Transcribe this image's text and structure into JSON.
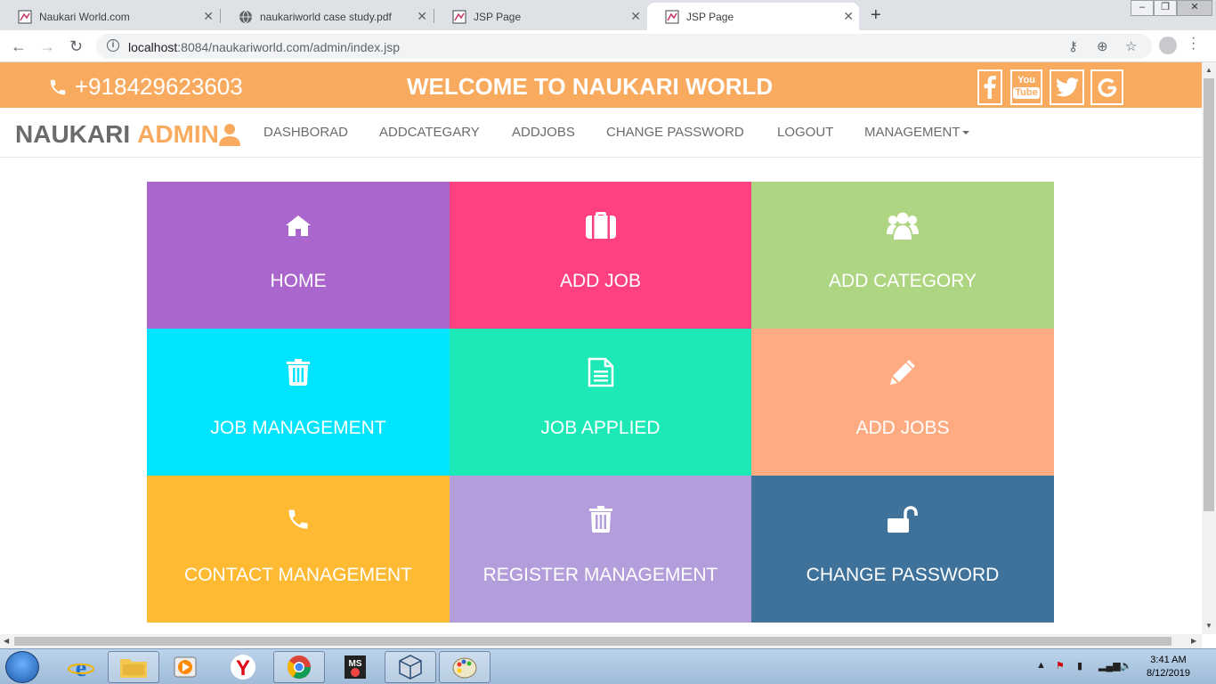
{
  "browser": {
    "tabs": [
      {
        "title": "Naukari World.com",
        "active": false
      },
      {
        "title": "naukariworld case study.pdf",
        "active": false
      },
      {
        "title": "JSP Page",
        "active": false
      },
      {
        "title": "JSP Page",
        "active": true
      }
    ],
    "url_host": "localhost",
    "url_rest": ":8084/naukariworld.com/admin/index.jsp"
  },
  "topbar": {
    "phone": "+918429623603",
    "welcome": "WELCOME TO NAUKARI WORLD",
    "social": [
      "facebook-icon",
      "youtube-icon",
      "twitter-icon",
      "google-icon"
    ]
  },
  "navbar": {
    "brand_main": "NAUKARI",
    "brand_accent": "ADMIN",
    "links": [
      "DASHBORAD",
      "ADDCATEGARY",
      "ADDJOBS",
      "CHANGE PASSWORD",
      "LOGOUT",
      "MANAGEMENT"
    ]
  },
  "tiles": [
    {
      "label": "HOME",
      "icon": "home-icon",
      "color": "#aa66cc"
    },
    {
      "label": "ADD JOB",
      "icon": "briefcase-icon",
      "color": "#ff4081"
    },
    {
      "label": "ADD CATEGORY",
      "icon": "users-icon",
      "color": "#aed581"
    },
    {
      "label": "JOB MANAGEMENT",
      "icon": "trash-icon",
      "color": "#00e5ff"
    },
    {
      "label": "JOB APPLIED",
      "icon": "document-icon",
      "color": "#1de9b6"
    },
    {
      "label": "ADD JOBS",
      "icon": "pencil-icon",
      "color": "#ffab82"
    },
    {
      "label": "CONTACT MANAGEMENT",
      "icon": "phone-icon",
      "color": "#ffba33"
    },
    {
      "label": "REGISTER MANAGEMENT",
      "icon": "trash-icon",
      "color": "#b39ddb"
    },
    {
      "label": "CHANGE PASSWORD",
      "icon": "unlock-icon",
      "color": "#3f729b"
    }
  ],
  "taskbar": {
    "time": "3:41 AM",
    "date": "8/12/2019"
  }
}
